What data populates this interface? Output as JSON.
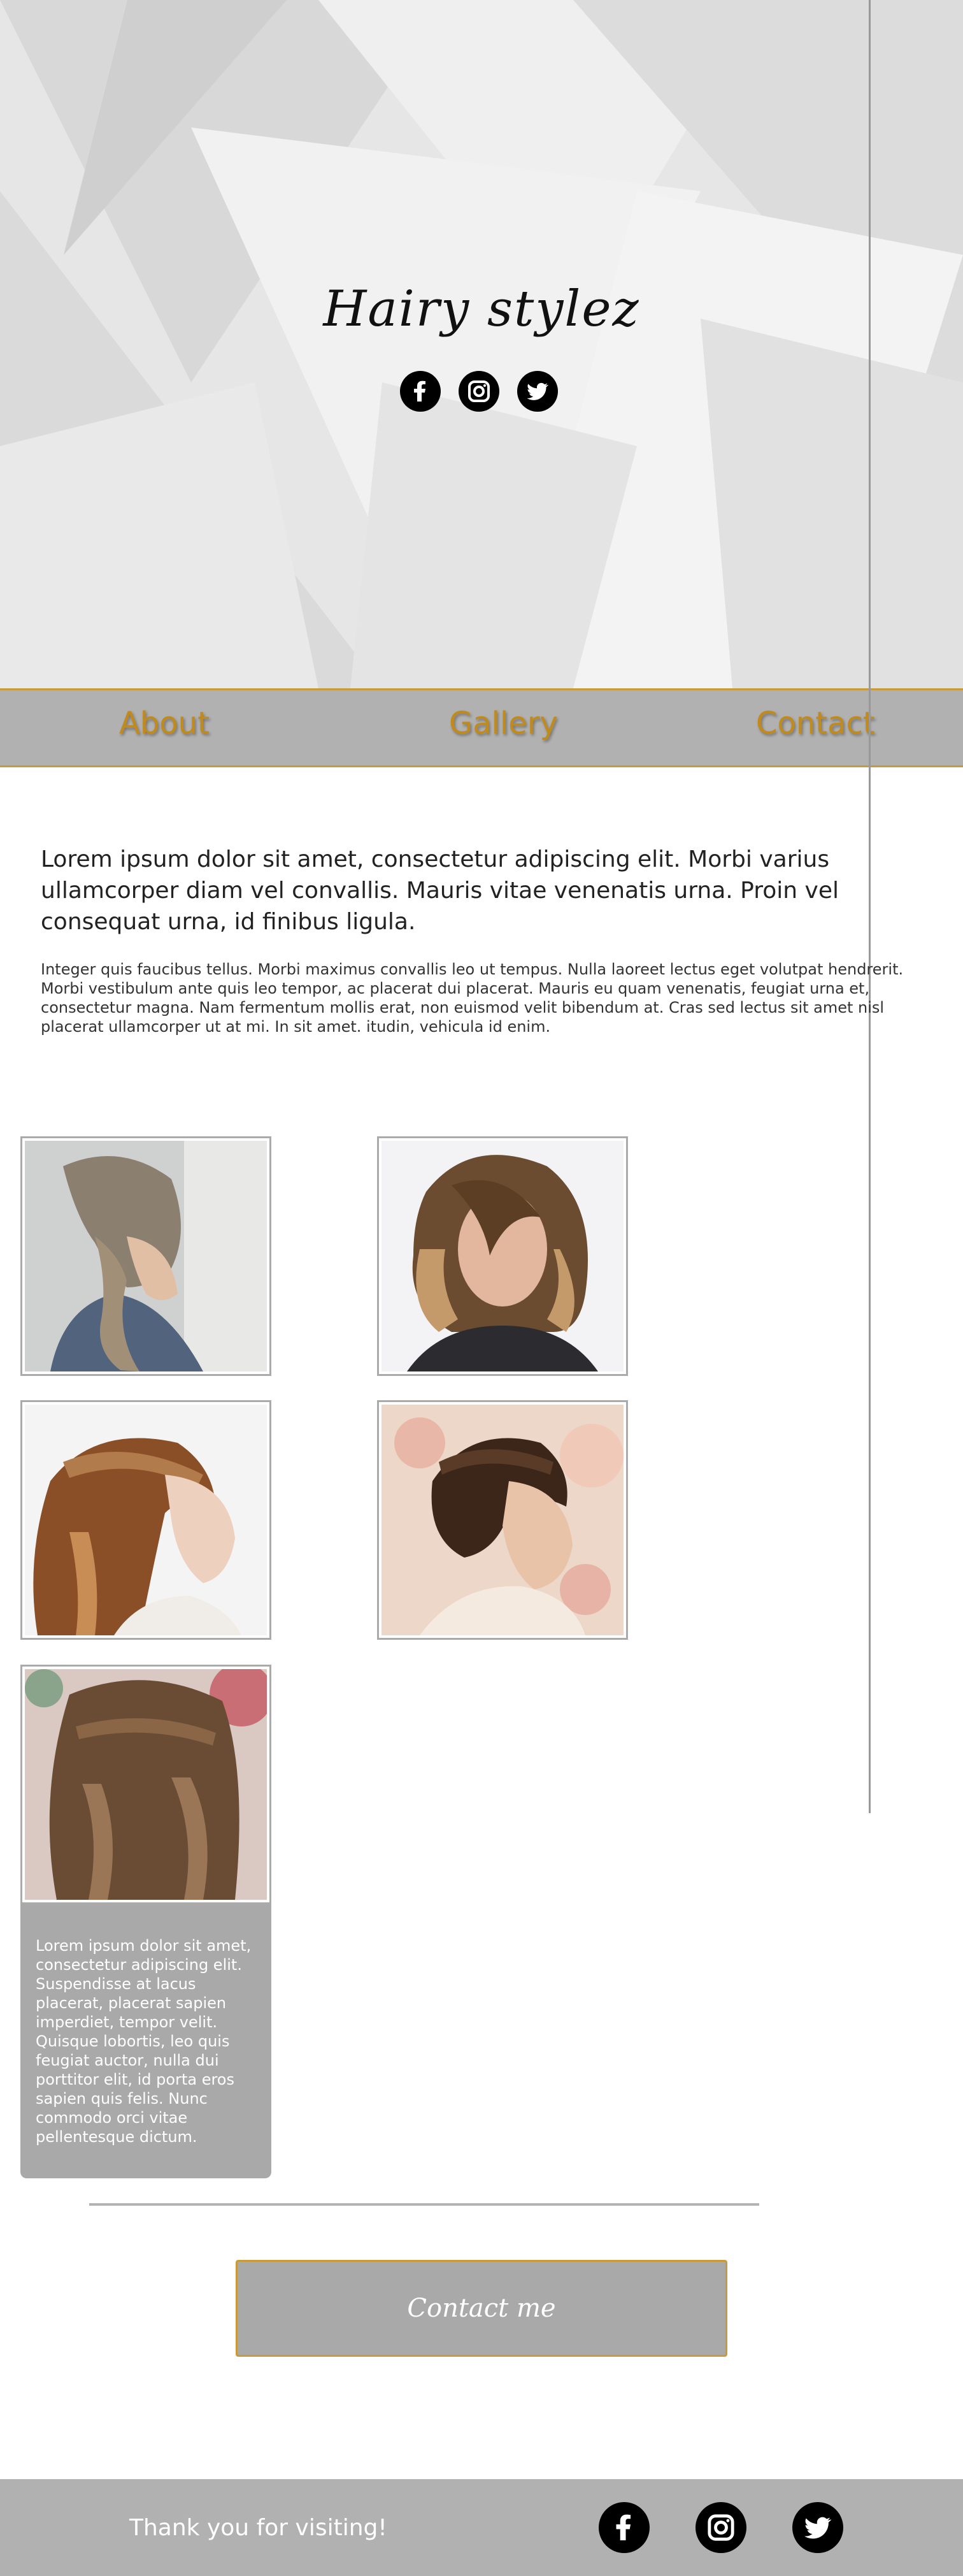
{
  "hero": {
    "title": "Hairy stylez",
    "social_icons": [
      "facebook-icon",
      "instagram-icon",
      "twitter-icon"
    ]
  },
  "nav": {
    "items": [
      "About",
      "Gallery",
      "Contact"
    ]
  },
  "intro": {
    "lead": "Lorem ipsum dolor sit amet, consectetur adipiscing elit. Morbi varius ullamcorper diam vel convallis. Mauris vitae venenatis urna. Proin vel consequat urna, id finibus ligula.",
    "body": "Integer quis faucibus tellus. Morbi maximus convallis leo ut tempus. Nulla laoreet lectus eget volutpat hendrerit. Morbi vestibulum ante quis leo tempor, ac placerat dui placerat. Mauris eu quam venenatis, feugiat urna et, consectetur magna. Nam fermentum mollis erat, non euismod velit bibendum at. Cras sed lectus sit amet nisl placerat ullamcorper ut at mi. In sit amet. itudin, vehicula id enim."
  },
  "gallery": {
    "caption": "Lorem ipsum dolor sit amet, consectetur adipiscing elit. Suspendisse at lacus placerat, placerat sapien imperdiet, tempor velit. Quisque lobortis, leo quis feugiat auctor, nulla dui porttitor elit, id porta eros sapien quis felis. Nunc commodo orci vitae pellentesque dictum."
  },
  "contact": {
    "button_label": "Contact me"
  },
  "footer": {
    "thanks": "Thank you for visiting!",
    "social_icons": [
      "facebook-icon",
      "instagram-icon",
      "twitter-icon"
    ]
  },
  "colors": {
    "accent": "#c08a1c",
    "nav_bg": "#b1b1b1",
    "caption_bg": "#a9a9a9"
  }
}
